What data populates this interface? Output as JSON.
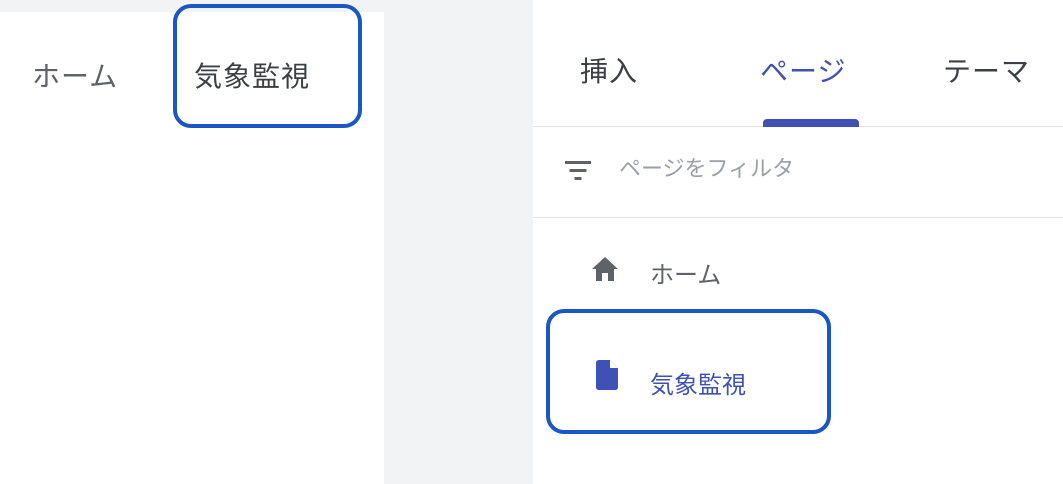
{
  "preview": {
    "nav": [
      {
        "label": "ホーム"
      },
      {
        "label": "気象監視"
      }
    ]
  },
  "panel": {
    "tabs": [
      {
        "label": "挿入"
      },
      {
        "label": "ページ",
        "active": true
      },
      {
        "label": "テーマ"
      }
    ],
    "filter": {
      "placeholder": "ページをフィルタ",
      "icon": "filter-icon"
    },
    "pages": [
      {
        "label": "ホーム",
        "icon": "home-icon"
      },
      {
        "label": "気象監視",
        "icon": "document-icon",
        "selected": true
      }
    ]
  },
  "colors": {
    "accent": "#3f51b5",
    "highlight": "#1a56c4",
    "text": "#5f6368",
    "gap": "#f1f3f4"
  }
}
